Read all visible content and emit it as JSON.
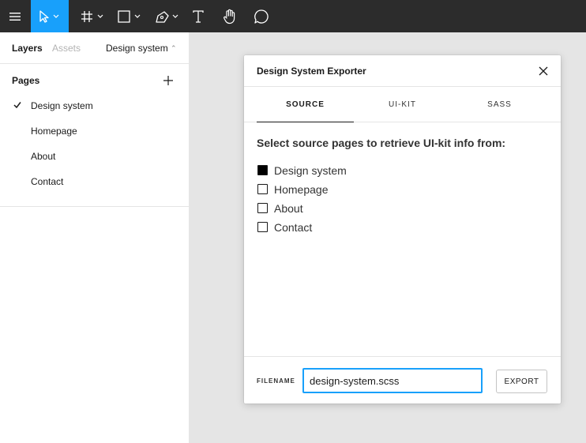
{
  "toolbar": {
    "tools": [
      "menu-icon",
      "move-tool-icon",
      "frame-tool-icon",
      "shape-tool-icon",
      "pen-tool-icon",
      "text-tool-icon",
      "hand-tool-icon",
      "comment-tool-icon"
    ],
    "active_color": "#18a0fb",
    "background": "#2c2c2c"
  },
  "left_panel": {
    "tabs": {
      "layers": "Layers",
      "assets": "Assets"
    },
    "current_page": "Design system",
    "pages_title": "Pages",
    "pages": [
      {
        "label": "Design system",
        "current": true
      },
      {
        "label": "Homepage",
        "current": false
      },
      {
        "label": "About",
        "current": false
      },
      {
        "label": "Contact",
        "current": false
      }
    ]
  },
  "dialog": {
    "title": "Design System Exporter",
    "tabs": [
      {
        "label": "SOURCE",
        "active": true
      },
      {
        "label": "UI-KIT",
        "active": false
      },
      {
        "label": "SASS",
        "active": false
      }
    ],
    "heading": "Select source pages to retrieve UI-kit info from:",
    "options": [
      {
        "label": "Design system",
        "checked": true
      },
      {
        "label": "Homepage",
        "checked": false
      },
      {
        "label": "About",
        "checked": false
      },
      {
        "label": "Contact",
        "checked": false
      }
    ],
    "filename_label": "FILENAME",
    "filename_value": "design-system.scss",
    "export_label": "EXPORT"
  }
}
